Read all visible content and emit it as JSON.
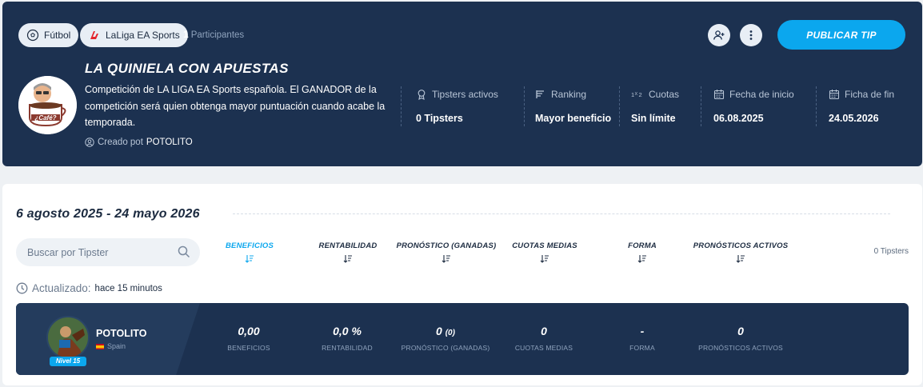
{
  "header": {
    "chips": [
      {
        "label": "Fútbol",
        "icon": "soccer-ball-icon"
      },
      {
        "label": "LaLiga EA Sports",
        "icon": "laliga-logo-icon"
      }
    ],
    "participants_count": "1",
    "participants_label": "Participantes",
    "publish_label": "PUBLICAR TIP",
    "icons": {
      "invite": "add-user-icon",
      "more": "more-vertical-icon"
    }
  },
  "competition": {
    "title": "LA QUINIELA CON APUESTAS",
    "description": "Competición de LA LIGA EA Sports española. El GANADOR de la competición será quien obtenga mayor puntuación cuando acabe la temporada.",
    "created_by_label": "Creado pot",
    "created_by_user": "POTOLITO",
    "stats": [
      {
        "label": "Tipsters activos",
        "value": "0 Tipsters",
        "icon": "award-icon"
      },
      {
        "label": "Ranking",
        "value": "Mayor beneficio",
        "icon": "ranking-icon"
      },
      {
        "label": "Cuotas",
        "value": "Sin límite",
        "icon": "1x2-icon"
      },
      {
        "label": "Fecha de inicio",
        "value": "06.08.2025",
        "icon": "calendar-icon"
      },
      {
        "label": "Ficha de fin",
        "value": "24.05.2026",
        "icon": "calendar-icon"
      }
    ]
  },
  "main": {
    "date_range": "6 agosto 2025 - 24 mayo 2026",
    "search_placeholder": "Buscar por Tipster",
    "columns": [
      {
        "label": "BENEFICIOS",
        "active": true
      },
      {
        "label": "RENTABILIDAD",
        "active": false
      },
      {
        "label": "PRONÓSTICO (GANADAS)",
        "active": false
      },
      {
        "label": "CUOTAS MEDIAS",
        "active": false
      },
      {
        "label": "FORMA",
        "active": false
      },
      {
        "label": "PRONÓSTICOS ACTIVOS",
        "active": false
      }
    ],
    "tipster_count": "0 Tipsters",
    "updated_label": "Actualizado:",
    "updated_value": "hace 15 minutos"
  },
  "row": {
    "name": "POTOLITO",
    "country": "Spain",
    "level": "Nivel 15",
    "metrics": [
      {
        "value": "0,00",
        "extra": "",
        "label": "BENEFICIOS"
      },
      {
        "value": "0,0 %",
        "extra": "",
        "label": "RENTABILIDAD"
      },
      {
        "value": "0",
        "extra": "(0)",
        "label": "PRONÓSTICO (GANADAS)"
      },
      {
        "value": "0",
        "extra": "",
        "label": "CUOTAS MEDIAS"
      },
      {
        "value": "-",
        "extra": "",
        "label": "FORMA"
      },
      {
        "value": "0",
        "extra": "",
        "label": "PRONÓSTICOS ACTIVOS"
      }
    ]
  },
  "colors": {
    "navy": "#1c3150",
    "accent": "#0ba7ee"
  }
}
